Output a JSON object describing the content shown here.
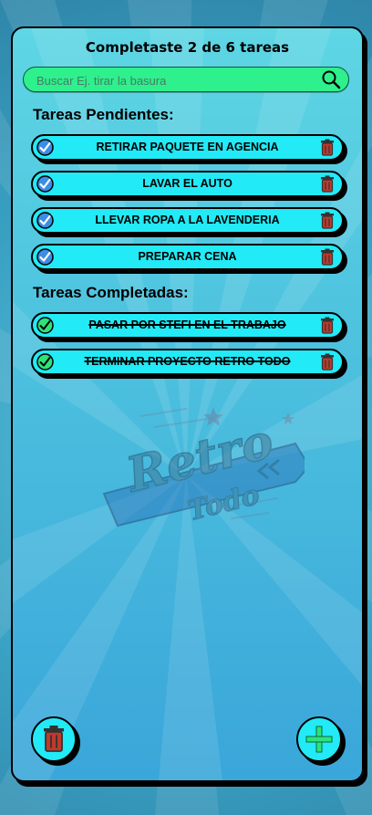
{
  "header": {
    "title": "Completaste 2 de 6 tareas"
  },
  "search": {
    "placeholder": "Buscar Ej. tirar la basura",
    "value": ""
  },
  "sections": {
    "pending_title": "Tareas Pendientes:",
    "completed_title": "Tareas Completadas:"
  },
  "pending_tasks": [
    {
      "label": "RETIRAR PAQUETE EN AGENCIA"
    },
    {
      "label": "LAVAR EL AUTO"
    },
    {
      "label": "LLEVAR ROPA A LA LAVENDERIA"
    },
    {
      "label": "PREPARAR CENA"
    }
  ],
  "completed_tasks": [
    {
      "label": "PASAR POR STEFI EN EL TRABAJO"
    },
    {
      "label": "TERMINAR PROYECTO RETRO TODO"
    }
  ],
  "logo": {
    "line1": "Retro",
    "line2": "Todo"
  },
  "actions": {
    "delete_all": "trash-icon",
    "add_task": "plus-icon"
  },
  "colors": {
    "task_bg": "#22eaf6",
    "search_bg": "#2ef08c",
    "pending_check": "#3a8ee6",
    "done_check": "#2ee27a",
    "trash": "#c0392b",
    "add": "#2ee27a"
  }
}
